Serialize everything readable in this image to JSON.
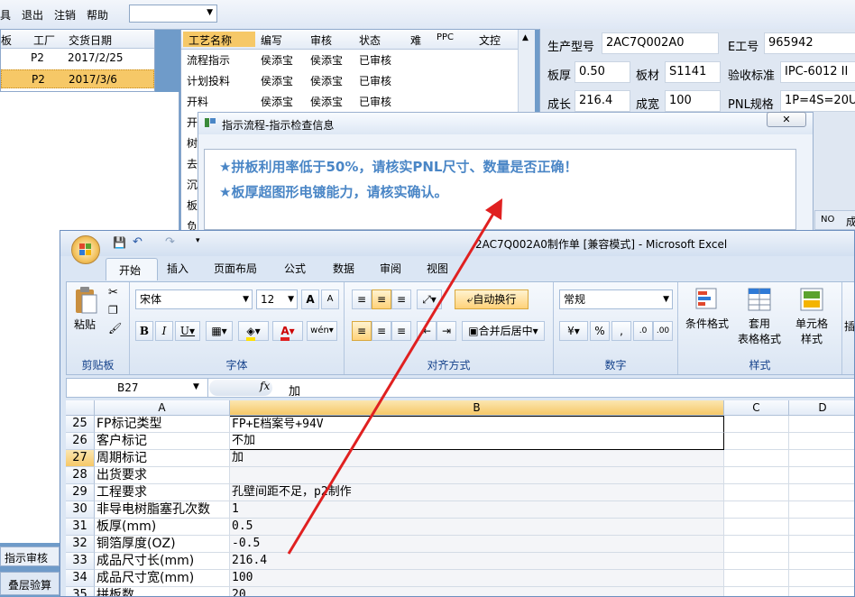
{
  "menubar": {
    "items": [
      "具",
      "退出",
      "注销",
      "帮助"
    ]
  },
  "left_grid": {
    "columns": [
      "板",
      "工厂",
      "交货日期"
    ],
    "rows": [
      {
        "factory": "P2",
        "date": "2017/2/25"
      },
      {
        "factory": "P2",
        "date": "2017/3/6"
      }
    ],
    "bottom_tabs": [
      "指示审核",
      "叠层验算"
    ]
  },
  "process_grid": {
    "columns": [
      "工艺名称",
      "编写",
      "审核",
      "状态",
      "难",
      "PPC",
      "文控"
    ],
    "rows": [
      {
        "name": "流程指示",
        "author": "侯添宝",
        "reviewer": "侯添宝",
        "status": "已审核"
      },
      {
        "name": "计划投料",
        "author": "侯添宝",
        "reviewer": "侯添宝",
        "status": "已审核"
      },
      {
        "name": "开料",
        "author": "侯添宝",
        "reviewer": "侯添宝",
        "status": "已审核"
      }
    ],
    "hidden_rows": [
      "开",
      "树",
      "去",
      "沉",
      "板",
      "负"
    ]
  },
  "detail_panel": {
    "model_label": "生产型号",
    "model_value": "2AC7Q002A0",
    "eno_label": "E工号",
    "eno_value": "965942",
    "thick_label": "板厚",
    "thick_value": "0.50",
    "mat_label": "板材",
    "mat_value": "S1141",
    "std_label": "验收标准",
    "std_value": "IPC-6012 II",
    "len_label": "成长",
    "len_value": "216.4",
    "wid_label": "成宽",
    "wid_value": "100",
    "pnl_label": "PNL规格",
    "pnl_value": "1P=4S=20U",
    "mini_head": [
      "NO",
      "成"
    ]
  },
  "dialog": {
    "title": "指示流程-指示检查信息",
    "lines": [
      "★拼板利用率低于50%，请核实PNL尺寸、数量是否正确！",
      "★板厚超图形电镀能力，请核实确认。"
    ]
  },
  "excel": {
    "title": "2AC7Q002A0制作单  [兼容模式] - Microsoft Excel",
    "tabs": [
      "开始",
      "插入",
      "页面布局",
      "公式",
      "数据",
      "审阅",
      "视图"
    ],
    "font_name": "宋体",
    "font_size": "12",
    "number_format": "常规",
    "labels": {
      "paste": "粘贴",
      "clipboard": "剪贴板",
      "font": "字体",
      "alignment": "对齐方式",
      "number": "数字",
      "styles": "样式",
      "wrap": "自动换行",
      "merge": "合并后居中",
      "cond_format": "条件格式",
      "table_format_1": "套用",
      "table_format_2": "表格格式",
      "cell_style_1": "单元格",
      "cell_style_2": "样式",
      "insert": "插"
    },
    "name_box": "B27",
    "formula_value": "加",
    "col_headers": [
      "A",
      "B",
      "C",
      "D"
    ],
    "rows": [
      {
        "n": "25",
        "a": "FP标记类型",
        "b": "FP+E档案号+94V"
      },
      {
        "n": "26",
        "a": "客户标记",
        "b": "不加"
      },
      {
        "n": "27",
        "a": "周期标记",
        "b": "加"
      },
      {
        "n": "28",
        "a": "出货要求",
        "b": ""
      },
      {
        "n": "29",
        "a": "工程要求",
        "b": "孔壁间距不足，p2制作"
      },
      {
        "n": "30",
        "a": "非导电树脂塞孔次数",
        "b": "1"
      },
      {
        "n": "31",
        "a": "板厚(mm)",
        "b": "0.5"
      },
      {
        "n": "32",
        "a": "铜箔厚度(OZ)",
        "b": "-0.5"
      },
      {
        "n": "33",
        "a": "成品尺寸长(mm)",
        "b": "216.4"
      },
      {
        "n": "34",
        "a": "成品尺寸宽(mm)",
        "b": "100"
      },
      {
        "n": "35",
        "a": "拼板数",
        "b": "20"
      }
    ]
  },
  "colors": {
    "accent_blue": "#4a86c6",
    "arrow_red": "#e02020",
    "selection_orange": "#f6c867"
  }
}
